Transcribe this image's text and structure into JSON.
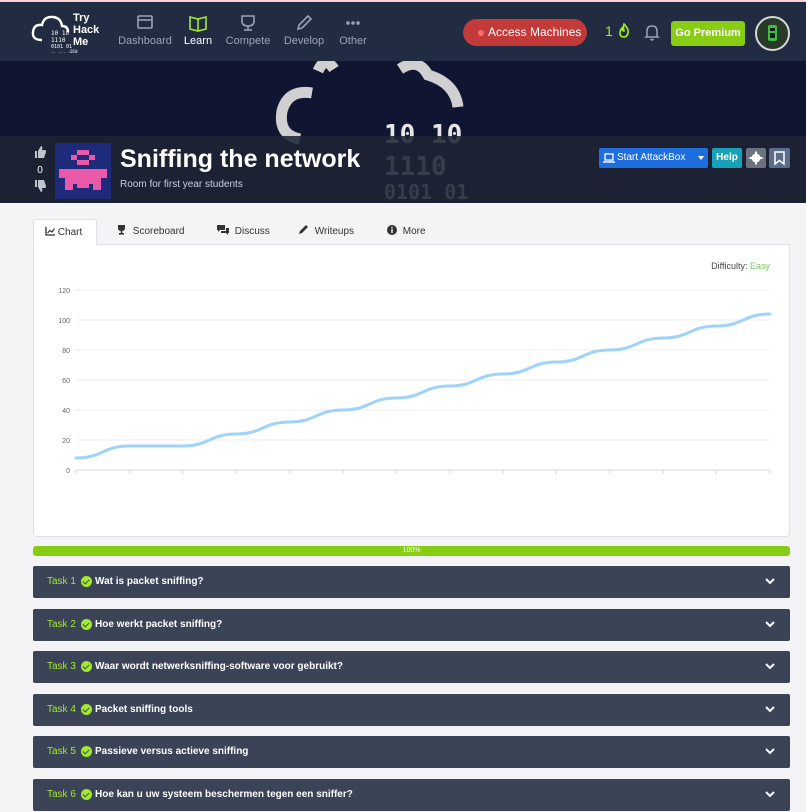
{
  "logo": {
    "text": "Try Hack Me"
  },
  "nav": [
    {
      "label": "Dashboard",
      "icon": "dashboard-icon",
      "active": false
    },
    {
      "label": "Learn",
      "icon": "book-icon",
      "active": true
    },
    {
      "label": "Compete",
      "icon": "trophy-icon",
      "active": false
    },
    {
      "label": "Develop",
      "icon": "pencil-icon",
      "active": false
    },
    {
      "label": "Other",
      "icon": "more-icon",
      "active": false
    }
  ],
  "header": {
    "access_label": "Access Machines",
    "streak": "1",
    "premium_label": "Go Premium"
  },
  "room": {
    "votes": "0",
    "title": "Sniffing the network",
    "subtitle": "Room for first year students",
    "attackbox_label": "Start AttackBox",
    "help_label": "Help"
  },
  "tabs": [
    {
      "label": "Chart",
      "icon": "chart-icon",
      "active": true
    },
    {
      "label": "Scoreboard",
      "icon": "trophy-icon"
    },
    {
      "label": "Discuss",
      "icon": "comments-icon"
    },
    {
      "label": "Writeups",
      "icon": "pen-icon"
    },
    {
      "label": "More",
      "icon": "info-icon"
    }
  ],
  "difficulty": {
    "label": "Difficulty:",
    "value": "Easy"
  },
  "chart_data": {
    "type": "line",
    "x": [
      0,
      1,
      2,
      3,
      4,
      5,
      6,
      7,
      8,
      9,
      10,
      11,
      12,
      13
    ],
    "y": [
      8,
      16,
      16,
      24,
      32,
      40,
      48,
      56,
      64,
      72,
      80,
      88,
      96,
      104
    ],
    "ylim": [
      0,
      120
    ],
    "yticks": [
      0,
      20,
      40,
      60,
      80,
      100,
      120
    ],
    "color": "#9fd3f7",
    "grid": true
  },
  "progress": {
    "value": 1.0,
    "label": "100%"
  },
  "tasks": [
    {
      "num": "Task 1",
      "title": "Wat is packet sniffing?"
    },
    {
      "num": "Task 2",
      "title": "Hoe werkt packet sniffing?"
    },
    {
      "num": "Task 3",
      "title": "Waar wordt netwerksniffing-software voor gebruikt?"
    },
    {
      "num": "Task 4",
      "title": "Packet sniffing tools"
    },
    {
      "num": "Task 5",
      "title": "Passieve versus actieve sniffing"
    },
    {
      "num": "Task 6",
      "title": "Hoe kan u uw systeem beschermen tegen een sniffer?"
    }
  ],
  "colors": {
    "accent": "#88cc14",
    "nav_bg": "#212c42",
    "task_bg": "#3b4357"
  }
}
